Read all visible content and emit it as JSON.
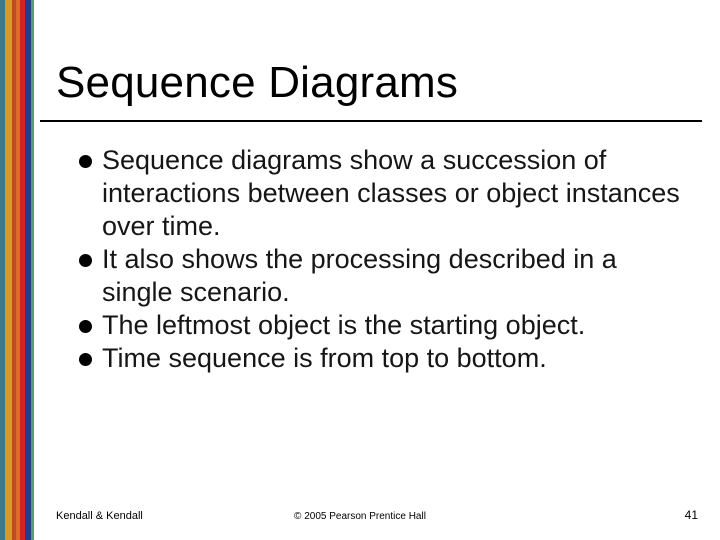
{
  "title": "Sequence Diagrams",
  "bullets": [
    "Sequence diagrams show a succession of interactions between classes or object instances over time.",
    "It also shows the processing described in a single scenario.",
    "The leftmost object is the starting object.",
    "Time sequence is from top to bottom."
  ],
  "footer": {
    "left": "Kendall & Kendall",
    "center": "© 2005 Pearson Prentice Hall",
    "right": "41"
  }
}
